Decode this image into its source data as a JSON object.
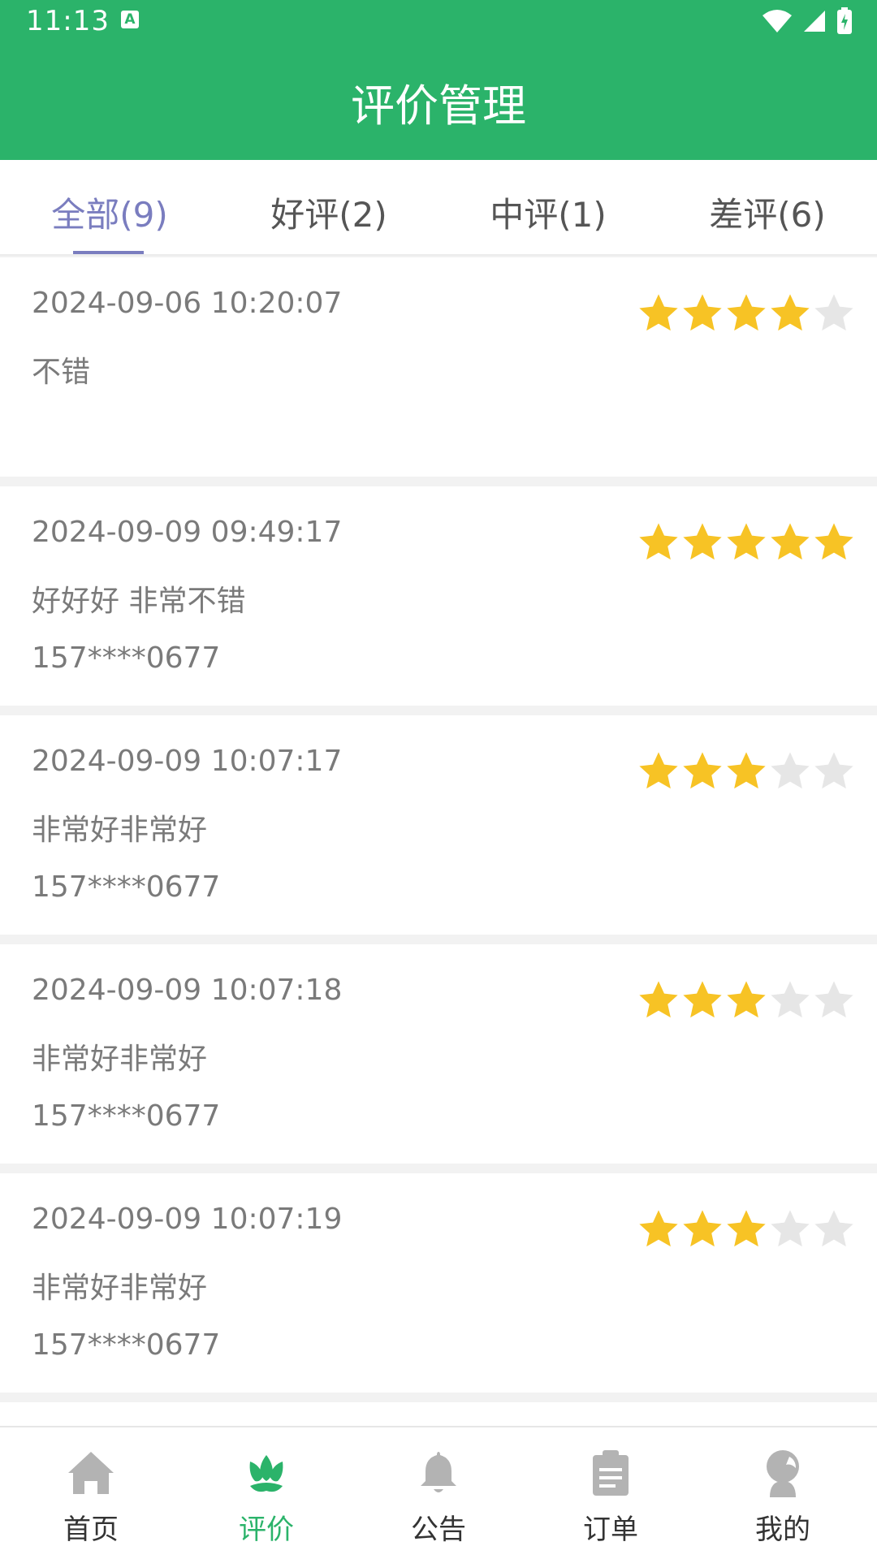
{
  "status_bar": {
    "time": "11:13",
    "notification_icon": "A"
  },
  "header": {
    "title": "评价管理"
  },
  "tabs": [
    {
      "label": "全部(9)",
      "active": true
    },
    {
      "label": "好评(2)",
      "active": false
    },
    {
      "label": "中评(1)",
      "active": false
    },
    {
      "label": "差评(6)",
      "active": false
    }
  ],
  "reviews": [
    {
      "time": "2024-09-06 10:20:07",
      "content": "不错",
      "phone": "",
      "rating": 4
    },
    {
      "time": "2024-09-09 09:49:17",
      "content": "好好好 非常不错",
      "phone": "157****0677",
      "rating": 5
    },
    {
      "time": "2024-09-09 10:07:17",
      "content": "非常好非常好",
      "phone": "157****0677",
      "rating": 3
    },
    {
      "time": "2024-09-09 10:07:18",
      "content": "非常好非常好",
      "phone": "157****0677",
      "rating": 3
    },
    {
      "time": "2024-09-09 10:07:19",
      "content": "非常好非常好",
      "phone": "157****0677",
      "rating": 3
    }
  ],
  "bottom_nav": [
    {
      "label": "首页",
      "icon": "home-icon",
      "active": false
    },
    {
      "label": "评价",
      "icon": "flower-icon",
      "active": true
    },
    {
      "label": "公告",
      "icon": "bell-icon",
      "active": false
    },
    {
      "label": "订单",
      "icon": "clipboard-icon",
      "active": false
    },
    {
      "label": "我的",
      "icon": "user-icon",
      "active": false
    }
  ],
  "colors": {
    "primary": "#2bb36a",
    "tab_active": "#7a7dbf",
    "star_on": "#f7c325",
    "star_off": "#e6e6e6",
    "nav_inactive_icon": "#b3b3b3"
  }
}
